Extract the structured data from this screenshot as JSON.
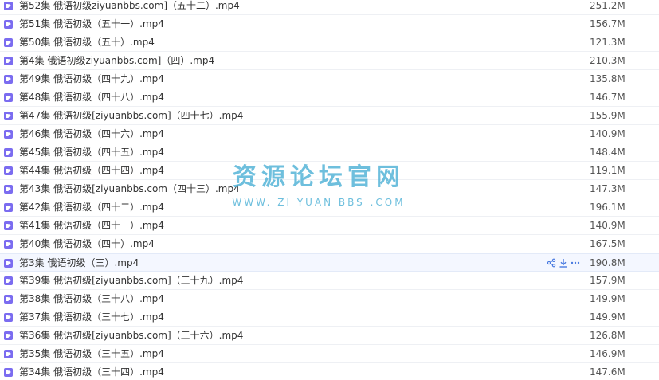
{
  "files": [
    {
      "name": "第52集 俄语初级ziyuanbbs.com]（五十二）.mp4",
      "size": "251.2M"
    },
    {
      "name": "第51集 俄语初级（五十一）.mp4",
      "size": "156.7M"
    },
    {
      "name": "第50集 俄语初级（五十）.mp4",
      "size": "121.3M"
    },
    {
      "name": "第4集 俄语初级ziyuanbbs.com]（四）.mp4",
      "size": "210.3M"
    },
    {
      "name": "第49集 俄语初级（四十九）.mp4",
      "size": "135.8M"
    },
    {
      "name": "第48集 俄语初级（四十八）.mp4",
      "size": "146.7M"
    },
    {
      "name": "第47集 俄语初级[ziyuanbbs.com]（四十七）.mp4",
      "size": "155.9M"
    },
    {
      "name": "第46集 俄语初级（四十六）.mp4",
      "size": "140.9M"
    },
    {
      "name": "第45集 俄语初级（四十五）.mp4",
      "size": "148.4M"
    },
    {
      "name": "第44集 俄语初级（四十四）.mp4",
      "size": "119.1M"
    },
    {
      "name": "第43集 俄语初级[ziyuanbbs.com（四十三）.mp4",
      "size": "147.3M"
    },
    {
      "name": "第42集 俄语初级（四十二）.mp4",
      "size": "196.1M"
    },
    {
      "name": "第41集 俄语初级（四十一）.mp4",
      "size": "140.9M"
    },
    {
      "name": "第40集 俄语初级（四十）.mp4",
      "size": "167.5M"
    },
    {
      "name": "第3集 俄语初级（三）.mp4",
      "size": "190.8M",
      "hovered": true
    },
    {
      "name": "第39集 俄语初级[ziyuanbbs.com]（三十九）.mp4",
      "size": "157.9M"
    },
    {
      "name": "第38集 俄语初级（三十八）.mp4",
      "size": "149.9M"
    },
    {
      "name": "第37集 俄语初级（三十七）.mp4",
      "size": "149.9M"
    },
    {
      "name": "第36集 俄语初级[ziyuanbbs.com]（三十六）.mp4",
      "size": "126.8M"
    },
    {
      "name": "第35集 俄语初级（三十五）.mp4",
      "size": "146.9M"
    },
    {
      "name": "第34集 俄语初级（三十四）.mp4",
      "size": "147.6M"
    }
  ],
  "icons": {
    "file": "video-file-icon",
    "share": "share-icon",
    "download": "download-icon",
    "more": "more-icon"
  },
  "colors": {
    "file_icon": "#7b6cf0",
    "action_icon": "#4a7be0",
    "watermark": "#55b4d8",
    "hover_row": "#f4f7ff"
  },
  "watermark": {
    "title": "资源论坛官网",
    "subtitle": "WWW. ZI YUAN BBS .COM"
  }
}
